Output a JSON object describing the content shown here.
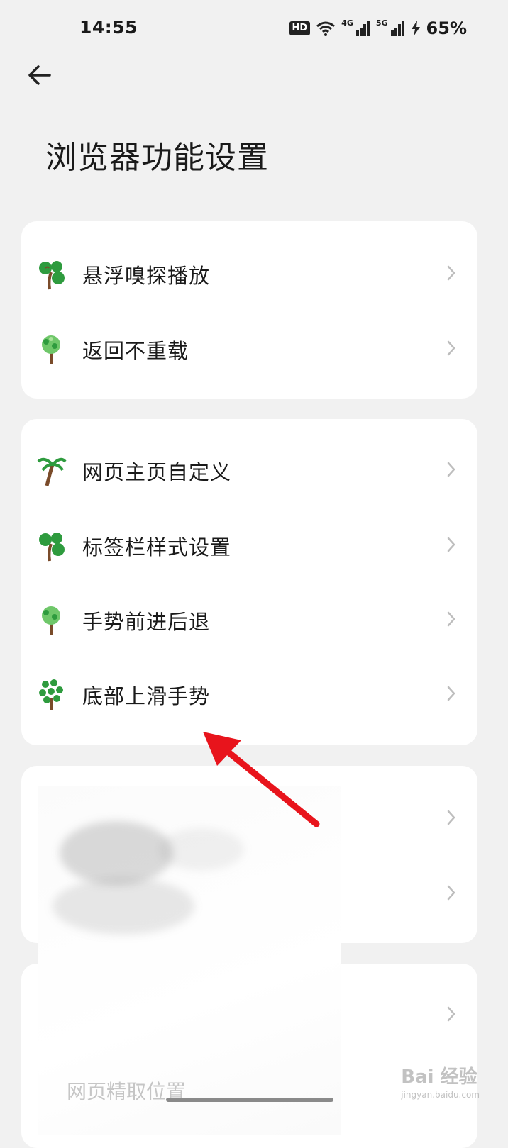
{
  "status_bar": {
    "time": "14:55",
    "hd_badge": "HD",
    "net1": "4G",
    "net2": "5G",
    "battery": "65%"
  },
  "header": {
    "back_icon": "arrow-left-icon",
    "title": "浏览器功能设置"
  },
  "groups": [
    {
      "items": [
        {
          "label": "悬浮嗅探播放",
          "icon": "tree-icon"
        },
        {
          "label": "返回不重载",
          "icon": "tree-icon"
        }
      ]
    },
    {
      "items": [
        {
          "label": "网页主页自定义",
          "icon": "palm-tree-icon"
        },
        {
          "label": "标签栏样式设置",
          "icon": "tree-icon"
        },
        {
          "label": "手势前进后退",
          "icon": "tree-icon"
        },
        {
          "label": "底部上滑手势",
          "icon": "tree-icon"
        }
      ]
    }
  ],
  "obscured": {
    "partial_text": "网页精取位置"
  },
  "watermark": {
    "text": "Bai 经验",
    "sub": "jingyan.baidu.com"
  },
  "colors": {
    "background": "#f1f1f1",
    "card": "#ffffff",
    "arrow": "#e8141c",
    "icon_green": "#2e9b3e"
  }
}
